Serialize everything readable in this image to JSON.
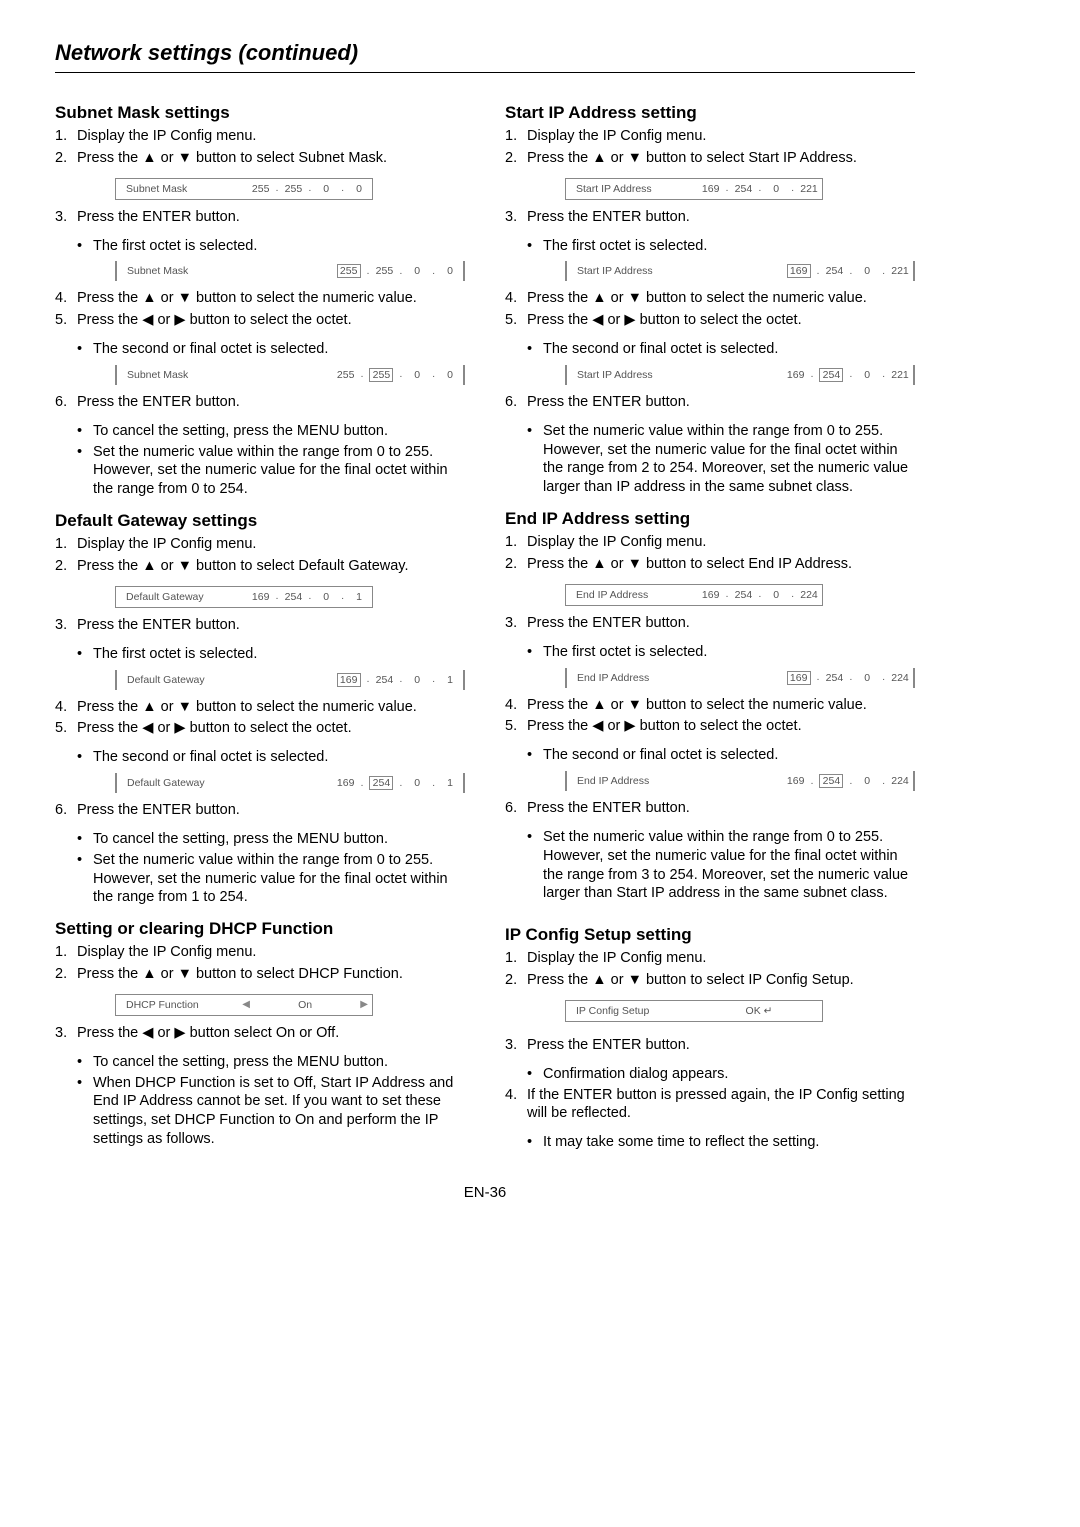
{
  "pageTitle": "Network settings (continued)",
  "footer": "EN-36",
  "arrows": {
    "up": "▲",
    "down": "▼",
    "left": "◀",
    "right": "▶"
  },
  "left": {
    "s1": {
      "title": "Subnet Mask settings",
      "st1": "Display the IP Config menu.",
      "st2a": "Press the ",
      "st2b": " or ",
      "st2c": " button to select Subnet Mask.",
      "osd1": {
        "label": "Subnet Mask",
        "o1": "255",
        "o2": "255",
        "o3": "0",
        "o4": "0"
      },
      "st3": "Press the ENTER button.",
      "b3": "The first octet is selected.",
      "osd2": {
        "label": "Subnet Mask",
        "o1": "255",
        "o2": "255",
        "o3": "0",
        "o4": "0"
      },
      "st4a": "Press the ",
      "st4b": " or ",
      "st4c": " button to select the numeric value.",
      "st5a": "Press the ",
      "st5b": " or ",
      "st5c": " button to select the octet.",
      "b5": "The second or final octet is selected.",
      "osd3": {
        "label": "Subnet Mask",
        "o1": "255",
        "o2": "255",
        "o3": "0",
        "o4": "0"
      },
      "st6": "Press the ENTER button.",
      "b6a": "To cancel the setting, press the MENU button.",
      "b6b": "Set the numeric value within the range from 0 to 255. However, set the numeric value for the final octet within the range from 0 to 254."
    },
    "s2": {
      "title": "Default Gateway settings",
      "st1": "Display the IP Config menu.",
      "st2a": "Press the ",
      "st2b": " or ",
      "st2c": " button to select Default Gateway.",
      "osd1": {
        "label": "Default Gateway",
        "o1": "169",
        "o2": "254",
        "o3": "0",
        "o4": "1"
      },
      "st3": "Press the ENTER button.",
      "b3": "The first octet is selected.",
      "osd2": {
        "label": "Default Gateway",
        "o1": "169",
        "o2": "254",
        "o3": "0",
        "o4": "1"
      },
      "st4a": "Press the ",
      "st4b": " or ",
      "st4c": " button to select the numeric value.",
      "st5a": "Press the ",
      "st5b": " or ",
      "st5c": " button to select the octet.",
      "b5": "The second or final octet is selected.",
      "osd3": {
        "label": "Default Gateway",
        "o1": "169",
        "o2": "254",
        "o3": "0",
        "o4": "1"
      },
      "st6": "Press the ENTER button.",
      "b6a": "To cancel the setting, press the MENU button.",
      "b6b": "Set the numeric value within the range from 0 to 255. However, set the numeric value for the final octet within the range from 1 to 254."
    },
    "s3": {
      "title": "Setting or clearing DHCP Function",
      "st1": "Display the IP Config menu.",
      "st2a": "Press the ",
      "st2b": " or ",
      "st2c": " button to select DHCP Function.",
      "osd1": {
        "label": "DHCP Function",
        "val": "On"
      },
      "st3a": "Press the ",
      "st3b": " or ",
      "st3c": " button select On or Off.",
      "b3a": "To cancel the setting, press the MENU button.",
      "b3b": "When DHCP Function is set to Off, Start IP Address and End IP Address cannot be set. If you want to set these settings, set DHCP Function to On and perform the IP settings as follows."
    }
  },
  "right": {
    "s1": {
      "title": "Start IP Address setting",
      "st1": "Display the IP Config menu.",
      "st2a": "Press the ",
      "st2b": " or ",
      "st2c": " button to select Start IP Address.",
      "osd1": {
        "label": "Start IP Address",
        "o1": "169",
        "o2": "254",
        "o3": "0",
        "o4": "221"
      },
      "st3": "Press the ENTER button.",
      "b3": "The first octet is selected.",
      "osd2": {
        "label": "Start IP Address",
        "o1": "169",
        "o2": "254",
        "o3": "0",
        "o4": "221"
      },
      "st4a": "Press the ",
      "st4b": " or ",
      "st4c": " button to select the numeric value.",
      "st5a": "Press the ",
      "st5b": " or ",
      "st5c": " button to select the octet.",
      "b5": "The second or final octet is selected.",
      "osd3": {
        "label": "Start IP Address",
        "o1": "169",
        "o2": "254",
        "o3": "0",
        "o4": "221"
      },
      "st6": "Press the ENTER button.",
      "b6": "Set the numeric value within the range from 0 to 255. However, set the numeric value for the final octet within the range from 2 to 254. Moreover, set the numeric value larger than IP address in the same subnet class."
    },
    "s2": {
      "title": "End IP Address setting",
      "st1": "Display the IP Config menu.",
      "st2a": "Press the ",
      "st2b": " or ",
      "st2c": " button to select End IP Address.",
      "osd1": {
        "label": "End IP Address",
        "o1": "169",
        "o2": "254",
        "o3": "0",
        "o4": "224"
      },
      "st3": "Press the ENTER button.",
      "b3": "The first octet is selected.",
      "osd2": {
        "label": "End IP Address",
        "o1": "169",
        "o2": "254",
        "o3": "0",
        "o4": "224"
      },
      "st4a": "Press the ",
      "st4b": " or ",
      "st4c": " button to select the numeric value.",
      "st5a": "Press the ",
      "st5b": " or ",
      "st5c": " button to select the octet.",
      "b5": "The second or final octet is selected.",
      "osd3": {
        "label": "End IP Address",
        "o1": "169",
        "o2": "254",
        "o3": "0",
        "o4": "224"
      },
      "st6": "Press the ENTER button.",
      "b6": "Set the numeric value within the range from 0 to 255. However, set the numeric value for the final octet within the range from 3 to 254. Moreover, set the numeric value larger than Start IP address in the same subnet class."
    },
    "s3": {
      "title": "IP Config Setup setting",
      "st1": "Display the IP Config menu.",
      "st2a": "Press the ",
      "st2b": " or ",
      "st2c": " button to select IP Config Setup.",
      "osd1": {
        "label": "IP Config Setup",
        "val": "OK ↵"
      },
      "st3": "Press the ENTER button.",
      "b3": "Confirmation dialog appears.",
      "st4": "If the ENTER button is pressed again, the IP Config setting will be reflected.",
      "b4": "It may take some time to reflect the setting."
    }
  }
}
